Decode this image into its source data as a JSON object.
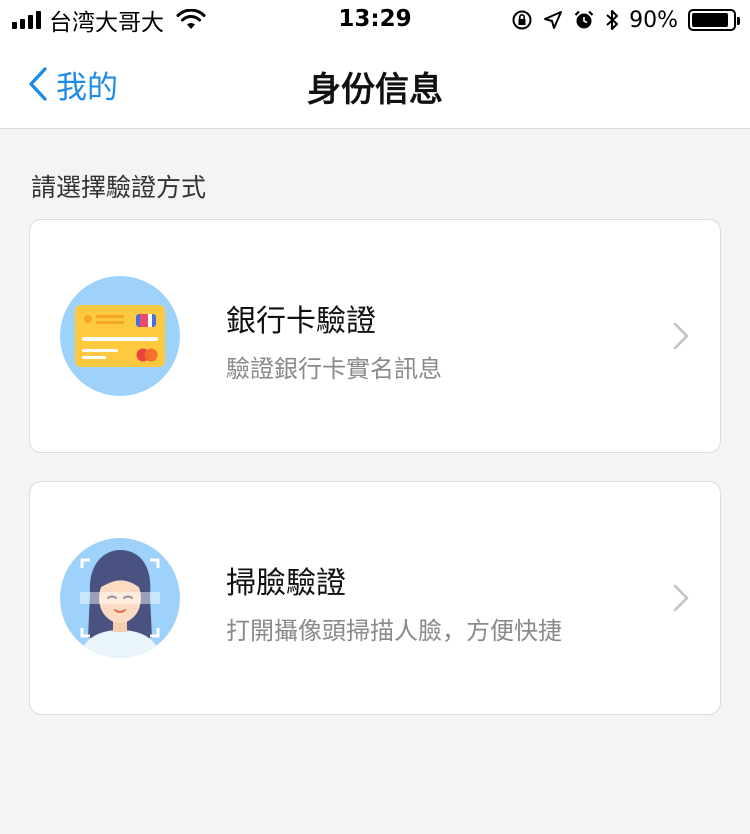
{
  "status_bar": {
    "carrier": "台湾大哥大",
    "time": "13:29",
    "battery_percent_text": "90%",
    "battery_level": 0.9
  },
  "nav": {
    "back_label": "我的",
    "title": "身份信息",
    "accent_color": "#1e8ce6"
  },
  "section_label": "請選擇驗證方式",
  "options": [
    {
      "icon": "bank-card-icon",
      "title": "銀行卡驗證",
      "description": "驗證銀行卡實名訊息"
    },
    {
      "icon": "face-scan-icon",
      "title": "掃臉驗證",
      "description": "打開攝像頭掃描人臉，方便快捷"
    }
  ]
}
